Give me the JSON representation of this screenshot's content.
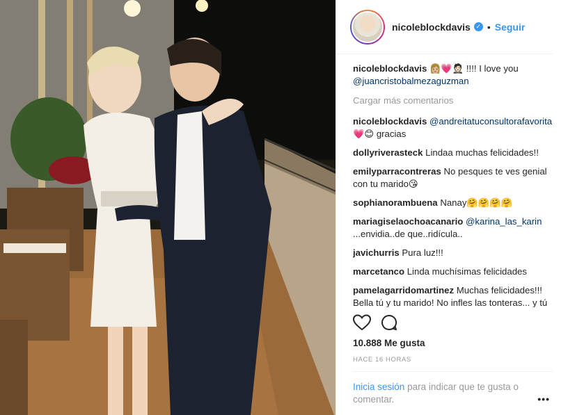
{
  "post": {
    "username": "nicoleblockdavis",
    "verified_glyph": "✓",
    "separator": "•",
    "follow_label": "Seguir",
    "caption_user": "nicoleblockdavis",
    "caption_emoji": "👩🏼💗🤵🏻",
    "caption_text": "!!!! I love you",
    "caption_mention": "@juancristobalmezaguzman",
    "load_more": "Cargar más comentarios",
    "comments": [
      {
        "user": "nicoleblockdavis",
        "mention": "@andreitatuconsultorafavorita",
        "text": "💗😊 gracias"
      },
      {
        "user": "dollyriverasteck",
        "mention": "",
        "text": "Lindaa muchas felicidades!!"
      },
      {
        "user": "emilyparracontreras",
        "mention": "",
        "text": "No pesques te ves genial con tu marido😘"
      },
      {
        "user": "sophianorambuena",
        "mention": "",
        "text": "Nanay🤗🤗🤗🤗"
      },
      {
        "user": "mariagiselaochoacanario",
        "mention": "@karina_las_karin",
        "text": "...envidia..de que..ridícula.."
      },
      {
        "user": "javichurris",
        "mention": "",
        "text": "Pura luz!!!"
      },
      {
        "user": "marcetanco",
        "mention": "",
        "text": "Linda muchísimas felicidades"
      },
      {
        "user": "pamelagarridomartinez",
        "mention": "",
        "text": "Muchas felicidades!!! Bella tú y tu marido! No infles las tonteras... y tú vestidoooo😍😍... ou la"
      }
    ],
    "likes": "10.888 Me gusta",
    "timestamp": "HACE 16 HORAS",
    "login_link": "Inicia sesión",
    "login_text": "para indicar que te gusta o comentar.",
    "options_glyph": "•••",
    "icons": [
      "heart-icon",
      "comment-icon",
      "verified-icon",
      "options-icon"
    ],
    "colors": {
      "link": "#3897f0",
      "muted": "#999999",
      "mention": "#003569"
    }
  }
}
